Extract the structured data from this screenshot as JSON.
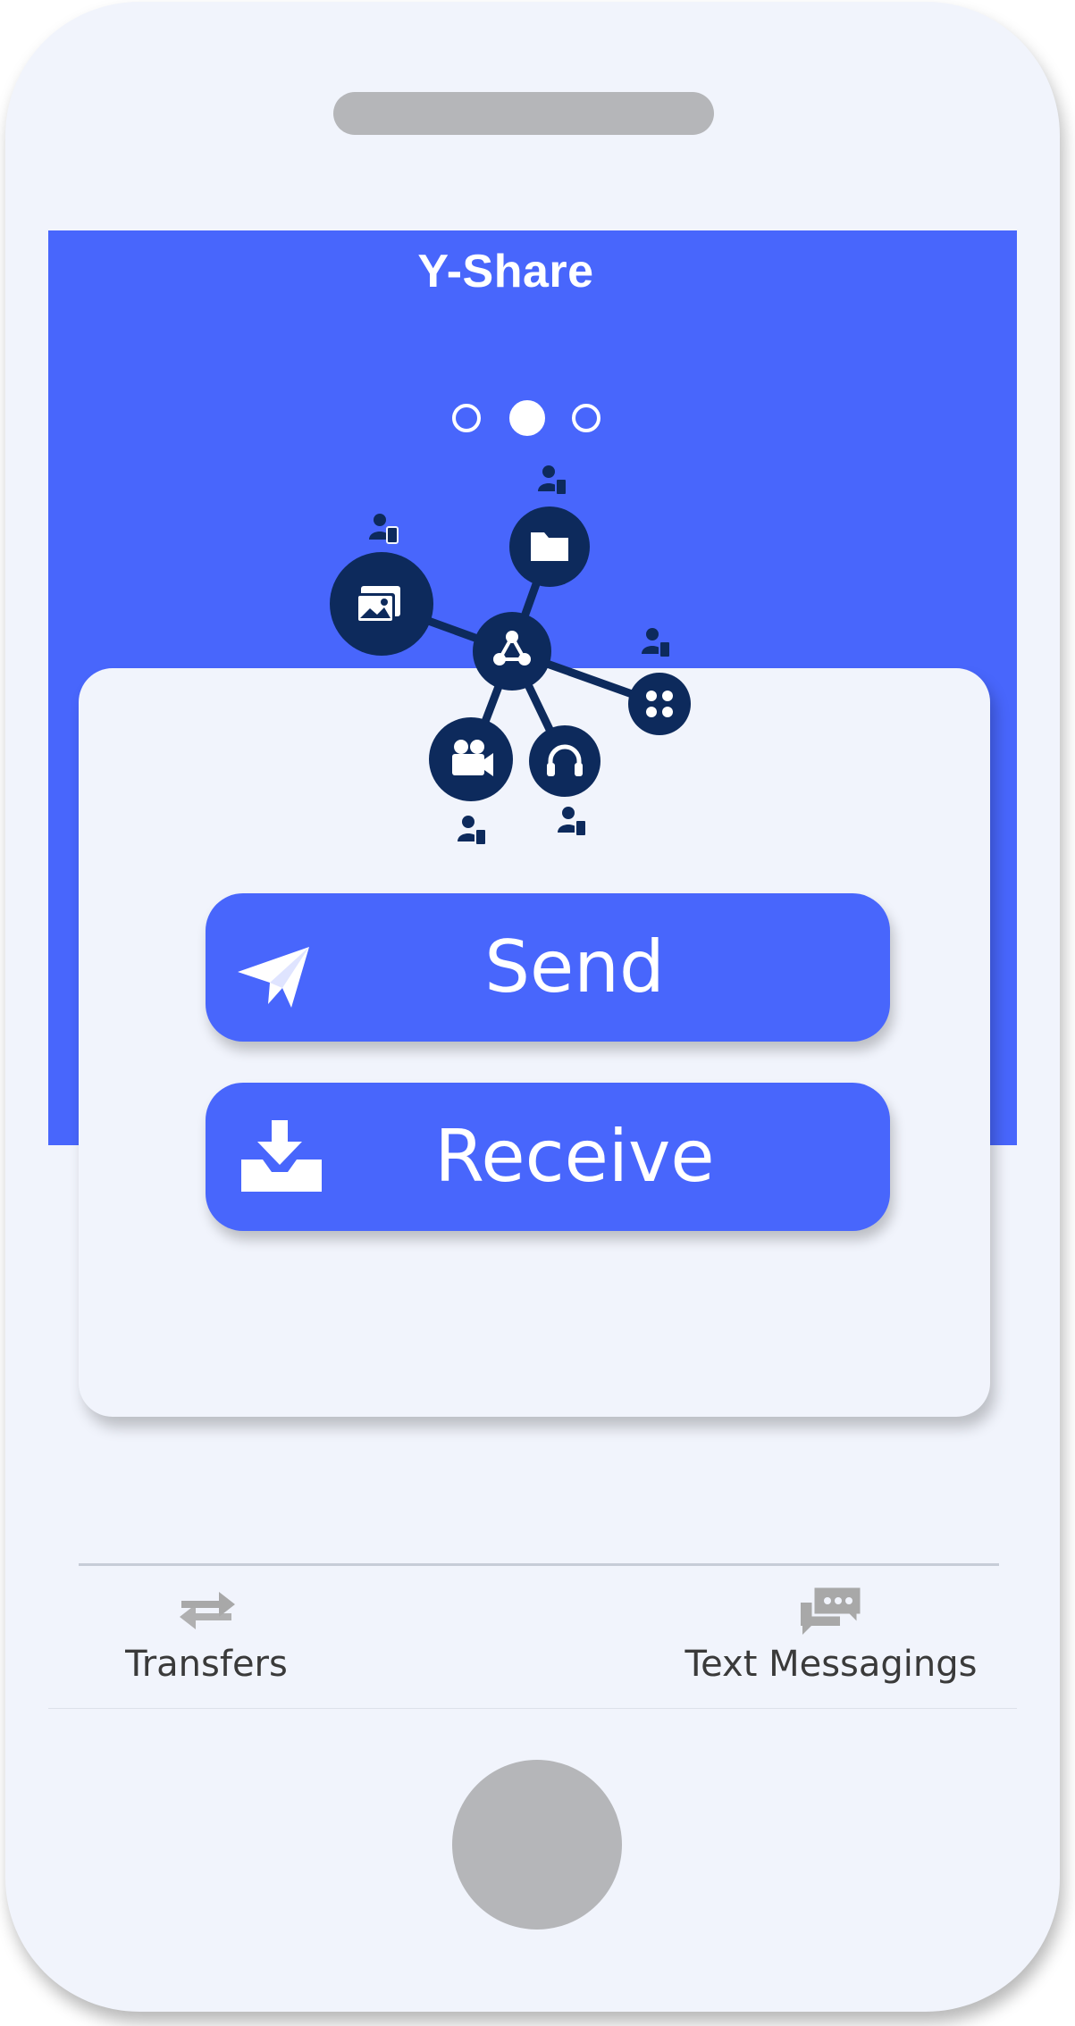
{
  "app": {
    "title": "Y-Share"
  },
  "pager": {
    "total_pages": 3,
    "active_page": 2
  },
  "actions": {
    "send_label": "Send",
    "receive_label": "Receive"
  },
  "bottom_nav": {
    "items": [
      {
        "label": "Transfers",
        "icon": "transfer-arrows-icon"
      },
      {
        "label": "Text Messagings",
        "icon": "chat-bubbles-icon"
      }
    ]
  },
  "illustration": {
    "hub_icon": "share-hub-icon",
    "nodes": [
      "photos-icon",
      "folder-icon",
      "apps-icon",
      "video-camera-icon",
      "headphones-icon"
    ]
  },
  "colors": {
    "accent": "#4866fc",
    "node": "#0d2a5c",
    "background": "#f1f4fc",
    "hardware_gray": "#b5b6b9",
    "nav_gray": "#a8a8a8"
  }
}
